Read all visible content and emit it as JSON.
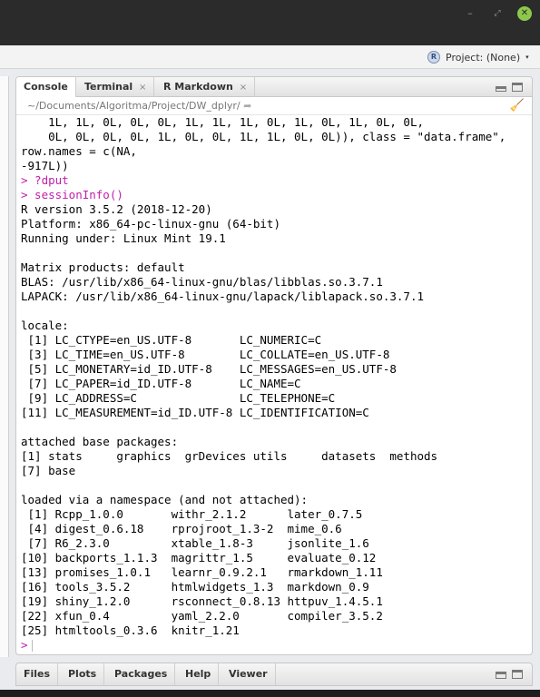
{
  "window": {
    "minimize_glyph": "–",
    "maximize_glyph": "⤢",
    "close_glyph": "✕"
  },
  "project": {
    "icon_letter": "R",
    "label": "Project: (None)",
    "caret": "▾"
  },
  "tabs": [
    {
      "label": "Console"
    },
    {
      "label": "Terminal",
      "close": "×"
    },
    {
      "label": "R Markdown",
      "close": "×"
    }
  ],
  "path": {
    "text": "~/Documents/Algoritma/Project/DW_dplyr/"
  },
  "console_lines": [
    {
      "text": "    1L, 1L, 0L, 0L, 0L, 1L, 1L, 1L, 0L, 1L, 0L, 1L, 0L, 0L,",
      "kind": "out"
    },
    {
      "text": "    0L, 0L, 0L, 0L, 1L, 0L, 0L, 1L, 1L, 0L, 0L)), class = \"data.frame\",",
      "kind": "out"
    },
    {
      "text": "row.names = c(NA,",
      "kind": "out"
    },
    {
      "text": "-917L))",
      "kind": "out"
    },
    {
      "text": "> ?dput",
      "kind": "cmd"
    },
    {
      "text": "> sessionInfo()",
      "kind": "cmd"
    },
    {
      "text": "R version 3.5.2 (2018-12-20)",
      "kind": "out"
    },
    {
      "text": "Platform: x86_64-pc-linux-gnu (64-bit)",
      "kind": "out"
    },
    {
      "text": "Running under: Linux Mint 19.1",
      "kind": "out"
    },
    {
      "text": "",
      "kind": "out"
    },
    {
      "text": "Matrix products: default",
      "kind": "out"
    },
    {
      "text": "BLAS: /usr/lib/x86_64-linux-gnu/blas/libblas.so.3.7.1",
      "kind": "out"
    },
    {
      "text": "LAPACK: /usr/lib/x86_64-linux-gnu/lapack/liblapack.so.3.7.1",
      "kind": "out"
    },
    {
      "text": "",
      "kind": "out"
    },
    {
      "text": "locale:",
      "kind": "out"
    },
    {
      "text": " [1] LC_CTYPE=en_US.UTF-8       LC_NUMERIC=C",
      "kind": "out"
    },
    {
      "text": " [3] LC_TIME=en_US.UTF-8        LC_COLLATE=en_US.UTF-8",
      "kind": "out"
    },
    {
      "text": " [5] LC_MONETARY=id_ID.UTF-8    LC_MESSAGES=en_US.UTF-8",
      "kind": "out"
    },
    {
      "text": " [7] LC_PAPER=id_ID.UTF-8       LC_NAME=C",
      "kind": "out"
    },
    {
      "text": " [9] LC_ADDRESS=C               LC_TELEPHONE=C",
      "kind": "out"
    },
    {
      "text": "[11] LC_MEASUREMENT=id_ID.UTF-8 LC_IDENTIFICATION=C",
      "kind": "out"
    },
    {
      "text": "",
      "kind": "out"
    },
    {
      "text": "attached base packages:",
      "kind": "out"
    },
    {
      "text": "[1] stats     graphics  grDevices utils     datasets  methods",
      "kind": "out"
    },
    {
      "text": "[7] base",
      "kind": "out"
    },
    {
      "text": "",
      "kind": "out"
    },
    {
      "text": "loaded via a namespace (and not attached):",
      "kind": "out"
    },
    {
      "text": " [1] Rcpp_1.0.0       withr_2.1.2      later_0.7.5",
      "kind": "out"
    },
    {
      "text": " [4] digest_0.6.18    rprojroot_1.3-2  mime_0.6",
      "kind": "out"
    },
    {
      "text": " [7] R6_2.3.0         xtable_1.8-3     jsonlite_1.6",
      "kind": "out"
    },
    {
      "text": "[10] backports_1.1.3  magrittr_1.5     evaluate_0.12",
      "kind": "out"
    },
    {
      "text": "[13] promises_1.0.1   learnr_0.9.2.1   rmarkdown_1.11",
      "kind": "out"
    },
    {
      "text": "[16] tools_3.5.2      htmlwidgets_1.3  markdown_0.9",
      "kind": "out"
    },
    {
      "text": "[19] shiny_1.2.0      rsconnect_0.8.13 httpuv_1.4.5.1",
      "kind": "out"
    },
    {
      "text": "[22] xfun_0.4         yaml_2.2.0       compiler_3.5.2",
      "kind": "out"
    },
    {
      "text": "[25] htmltools_0.3.6  knitr_1.21",
      "kind": "out"
    }
  ],
  "prompt": ">",
  "bottom_tabs": [
    {
      "label": "Files"
    },
    {
      "label": "Plots"
    },
    {
      "label": "Packages"
    },
    {
      "label": "Help"
    },
    {
      "label": "Viewer"
    }
  ]
}
